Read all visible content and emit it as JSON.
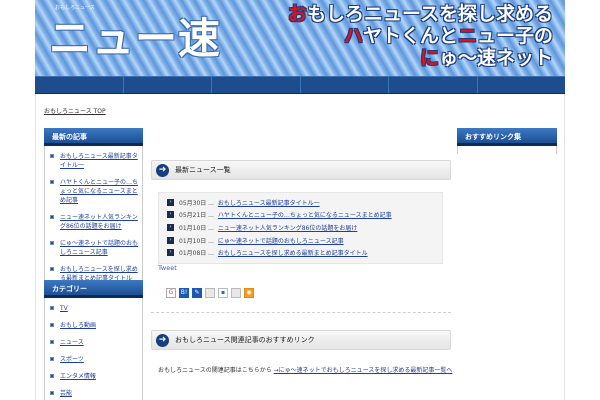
{
  "header": {
    "small_tagline": "おもしろニュース",
    "logo": "ニュー速",
    "slogan_line1": {
      "red": "お",
      "rest": "もしろニュースを探し求める"
    },
    "slogan_line2": {
      "red": "ハ",
      "rest": "ヤトくんと",
      "red2": "ニ",
      "rest2": "ュー子の"
    },
    "slogan_line3": {
      "red": "に",
      "rest": "ゅ～速ネット"
    }
  },
  "breadcrumb": {
    "label": "おもしろニュース TOP"
  },
  "left_sidebar": {
    "box1": {
      "title": "最新の記事",
      "items": [
        "おもしろニュース最新記事タイトル一",
        "ハヤトくんとニュー子の…ちょっと気になるニュースまとめ記事",
        "ニュー速ネット人気ランキング86位の話題をお届け",
        "にゅ～速ネットで話題のおもしろニュース記事",
        "おもしろニュースを探し求める最新まとめ記事タイトル"
      ]
    },
    "box2": {
      "title": "カテゴリー",
      "items": [
        "TV",
        "おもしろ動画",
        "ニュース",
        "スポーツ",
        "エンタメ情報",
        "芸能"
      ]
    }
  },
  "right_sidebar": {
    "title": "おすすめリンク集"
  },
  "news": {
    "title": "最新ニュース一覧",
    "items": [
      {
        "date": "05月30日 ...",
        "title": "おもしろニュース最新記事タイトル一"
      },
      {
        "date": "05月21日 ...",
        "title": "ハヤトくんとニュー子の…ちょっと気になるニュースまとめ記事"
      },
      {
        "date": "01月10日 ...",
        "title": "ニュー速ネット人気ランキング86位の話題をお届け"
      },
      {
        "date": "01月10日 ...",
        "title": "にゅ～速ネットで話題のおもしろニュース記事"
      },
      {
        "date": "01月08日 ...",
        "title": "おもしろニュースを探し求める最新まとめ記事タイトル"
      }
    ],
    "tweet_label": "Tweet"
  },
  "share_icons": [
    {
      "name": "google-bookmark-icon",
      "glyph": "G"
    },
    {
      "name": "hatena-bookmark-icon",
      "glyph": "B!"
    },
    {
      "name": "livedoor-clip-icon",
      "glyph": "✎"
    },
    {
      "name": "buzzurl-icon",
      "glyph": ""
    },
    {
      "name": "delicious-icon",
      "glyph": "▪"
    },
    {
      "name": "yahoo-bookmark-icon",
      "glyph": ""
    },
    {
      "name": "rss-icon",
      "glyph": "◉"
    }
  ],
  "related": {
    "title": "おもしろニュース関連記事のおすすめリンク",
    "text": "おもしろニュースの関連記事はこちらから",
    "link": "→にゅ～速ネットでおもしろニュースを探し求める最新記事一覧へ"
  },
  "colors": {
    "nav": "#1d4d8d",
    "link": "#1e3f9c",
    "accent_red": "#e3101a"
  }
}
